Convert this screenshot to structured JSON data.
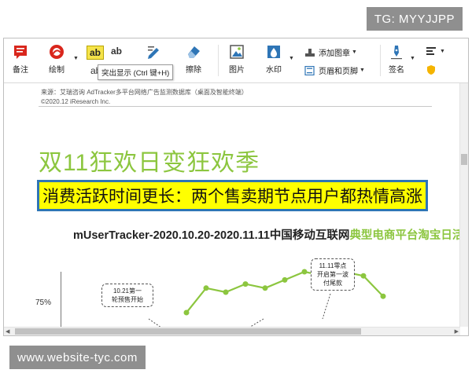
{
  "watermarks": {
    "top": "TG: MYYJJPP",
    "bottom": "www.website-tyc.com"
  },
  "toolbar": {
    "annotate_label": "备注",
    "draw_label": "绘制",
    "highlight_icon_text": "ab",
    "text_icon_text": "ab",
    "ab_bottom": "ab",
    "tooltip": "突出显示 (Ctrl 键+H)",
    "erase_label": "擦除",
    "image_label": "图片",
    "watermark_label": "水印",
    "add_stamp_label": "添加图章",
    "header_footer_label": "页眉和页脚",
    "sign_label": "签名",
    "colors": {
      "red": "#d9261c",
      "green": "#8cc63f",
      "blue": "#2e75b6"
    }
  },
  "document": {
    "source_line": "来源：艾瑞咨询 AdTracker多平台网络广告监测数据库（桌面及智能终端）",
    "copyright_line": "©2020.12 iResearch Inc.",
    "title": "双11狂欢日变狂欢季",
    "subtitle": "消费活跃时间更长：两个售卖期节点用户都热情高涨",
    "chart_title_main": "mUserTracker-2020.10.20-2020.11.11中国移动互联网",
    "chart_title_highlight": "典型电商平台淘宝日活",
    "callout_1": "10.21第一\n轮预售开始",
    "callout_2": "11.11零点\n开启第一波\n付尾款",
    "y_tick": "75%"
  },
  "chart_data": {
    "type": "line",
    "title": "mUserTracker-2020.10.20-2020.11.11中国移动互联网典型电商平台淘宝日活",
    "y_tick_labels": [
      "75%"
    ],
    "annotations": [
      "10.21第一轮预售开始",
      "11.11零点开启第一波付尾款"
    ],
    "line_color": "#8cc63f",
    "visible_points_y": [
      66,
      72,
      71,
      73,
      72,
      74,
      76,
      75,
      76,
      75,
      70
    ]
  }
}
